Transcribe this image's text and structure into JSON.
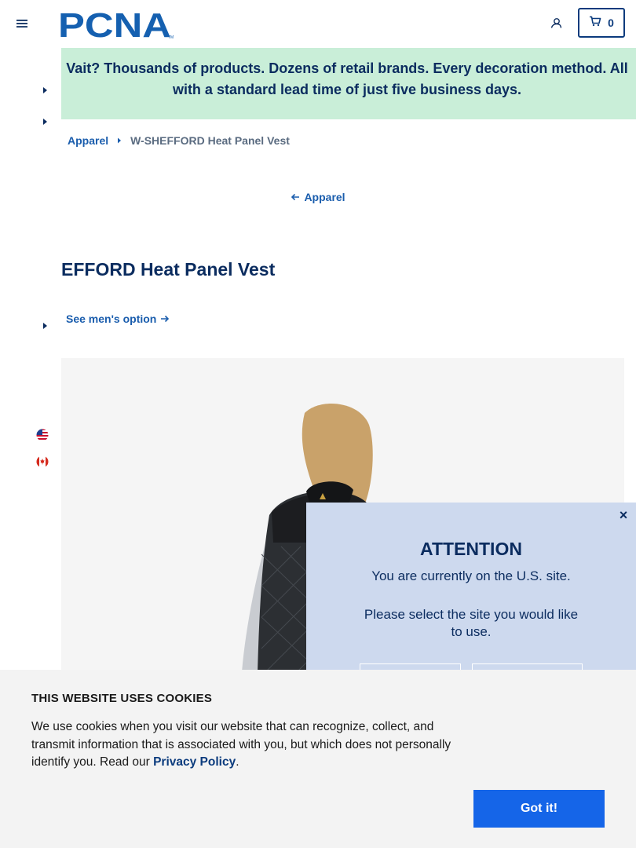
{
  "header": {
    "logo_text": "PCNA",
    "logo_tm": "TM",
    "cart_count": "0"
  },
  "banner": {
    "text": "Vait? Thousands of products. Dozens of retail brands. Every decoration method. All with a standard lead time of just five business days."
  },
  "breadcrumb": {
    "parent": "Apparel",
    "current": "W-SHEFFORD Heat Panel Vest"
  },
  "back_link": "Apparel",
  "product": {
    "title": "EFFORD Heat Panel Vest",
    "mens_option": "See men's option"
  },
  "modal": {
    "close": "×",
    "title": "ATTENTION",
    "line1": "You are currently on the U.S. site.",
    "line2": "Please select the site you would like to use."
  },
  "cookie": {
    "title": "THIS WEBSITE USES COOKIES",
    "text_before": "We use cookies when you visit our website that can recognize, collect, and transmit information that is associated with you, but which does not personally identify you. Read our ",
    "link": "Privacy Policy",
    "text_after": ".",
    "button": "Got it!"
  },
  "colors": {
    "brand_blue": "#0b3b7d",
    "link_blue": "#1a5dad",
    "banner_green": "#c9eed8",
    "modal_bg": "#cdd9ee",
    "button_blue": "#1565e8"
  },
  "icons": [
    "hamburger-menu-icon",
    "account-icon",
    "cart-icon",
    "caret-right-icon",
    "arrow-left-icon",
    "arrow-right-icon",
    "us-flag-icon",
    "canada-flag-icon",
    "close-icon"
  ]
}
